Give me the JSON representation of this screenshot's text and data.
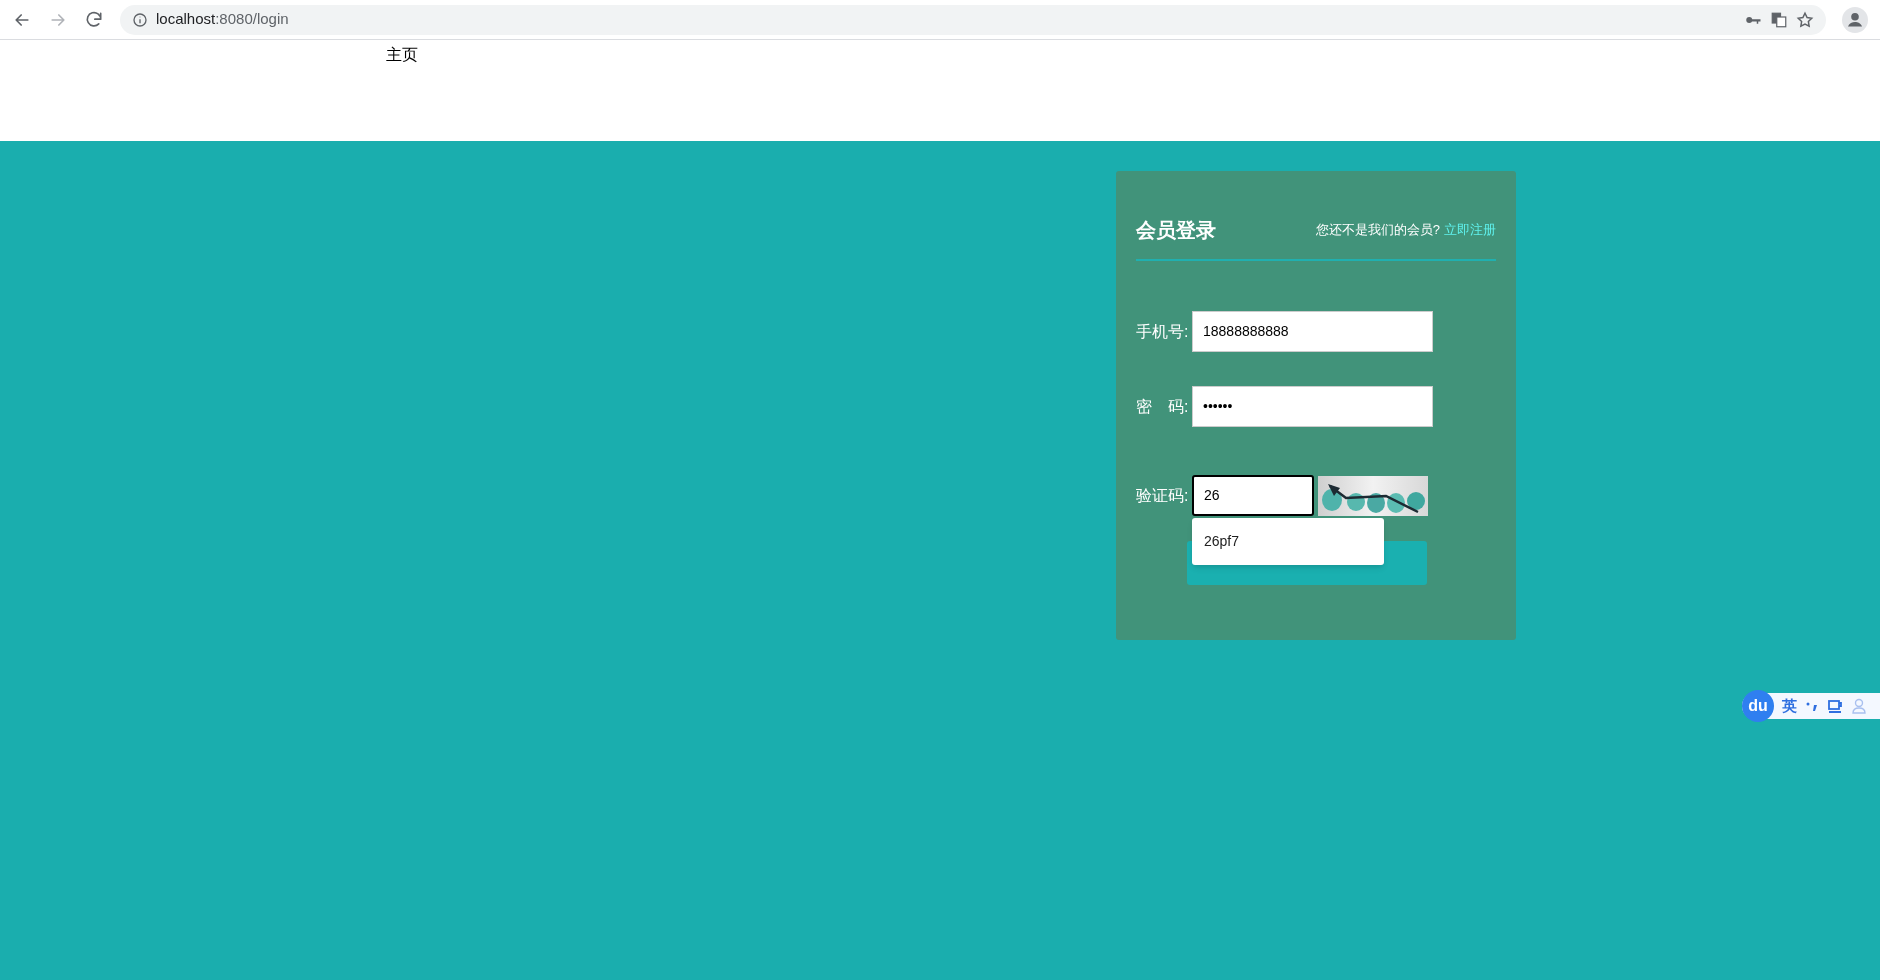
{
  "browser": {
    "url_host": "localhost",
    "url_rest": ":8080/login"
  },
  "nav": {
    "home": "主页"
  },
  "login": {
    "title": "会员登录",
    "prompt": "您还不是我们的会员?",
    "register_link": "立即注册",
    "fields": [
      {
        "kind": "text",
        "label": "手机号:",
        "value": "18888888888"
      },
      {
        "kind": "password",
        "label": "密　码:",
        "value": "••••••"
      },
      {
        "kind": "captcha",
        "label": "验证码:",
        "value": "26",
        "focused": true
      }
    ],
    "autocomplete": [
      "26pf7"
    ]
  },
  "ime": {
    "logo": "du",
    "mode": "英"
  }
}
